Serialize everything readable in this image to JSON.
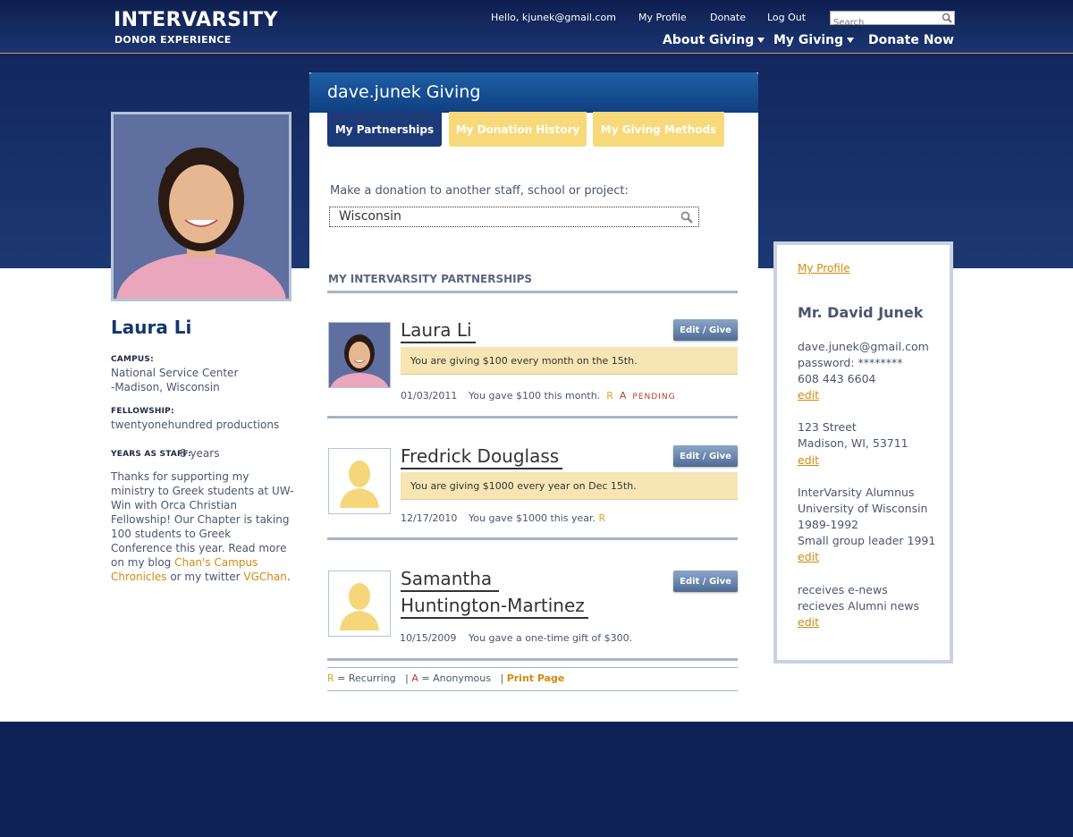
{
  "header": {
    "logo_main": "INTERVARSITY",
    "logo_sub": "DONOR EXPERIENCE",
    "greeting": "Hello, kjunek@gmail.com",
    "my_profile": "My Profile",
    "donate": "Donate",
    "logout": "Log Out",
    "search_placeholder": "Search",
    "nav": {
      "about": "About Giving",
      "my_giving": "My Giving",
      "donate_now": "Donate Now"
    }
  },
  "profile": {
    "name": "Laura Li",
    "campus_label": "CAMPUS:",
    "campus_line1": "National Service Center",
    "campus_line2": "-Madison, Wisconsin",
    "fellowship_label": "FELLOWSHIP:",
    "fellowship": "twentyonehundred productions",
    "years_label": "YEARS AS STAFF:",
    "years": "8 years",
    "bio_part1": "Thanks for supporting my ministry to Greek students at UW-Win with Orca Christian Fellowship! Our Chapter is taking 100 students to Greek Conference this year. Read more on my blog ",
    "blog_link": "Chan's Campus Chronicles",
    "bio_part2": " or my twitter ",
    "twitter_link": "VGChan",
    "bio_end": "."
  },
  "panel": {
    "title": "dave.junek Giving",
    "tabs": [
      "My Partnerships",
      "My Donation History",
      "My Giving Methods"
    ],
    "donate_label": "Make a donation to another staff, school or project:",
    "donate_value": "Wisconsin",
    "section_title": "MY INTERVARSITY PARTNERSHIPS",
    "edit_label": "Edit / Give",
    "partnerships": [
      {
        "name": "Laura Li",
        "giving": "You are giving $100 every month on the 15th.",
        "date": "01/03/2011",
        "note": "You gave $100 this month.",
        "r": "R",
        "a": "A",
        "status": "PENDING"
      },
      {
        "name": "Fredrick Douglass",
        "giving": "You are giving $1000 every year on Dec 15th.",
        "date": "12/17/2010",
        "note": "You gave $1000 this year.",
        "r": "R"
      },
      {
        "name_line1": "Samantha",
        "name_line2": "Huntington-Martinez",
        "date": "10/15/2009",
        "note": "You gave a one-time gift of $300."
      }
    ],
    "legend": {
      "r": "R",
      "r_text": "= Recurring",
      "a": "A",
      "a_text": "= Anonymous",
      "print": "Print Page"
    }
  },
  "sidebar": {
    "link": "My Profile",
    "name": "Mr. David Junek",
    "email": "dave.junek@gmail.com",
    "password": "password: ********",
    "phone": "608 443 6604",
    "street": "123 Street",
    "city": "Madison, WI, 53711",
    "alum1": "InterVarsity Alumnus",
    "alum2": "University of Wisconsin",
    "alum3": "1989-1992",
    "alum4": "Small group leader 1991",
    "news1": "receives e-news",
    "news2": "recieves Alumni news",
    "edit": "edit"
  },
  "colors": {
    "navy": "#0f2258",
    "accent_orange": "#d48a0e",
    "tab_yellow": "#f7d97a",
    "giving_bar": "#f7e6b4"
  }
}
